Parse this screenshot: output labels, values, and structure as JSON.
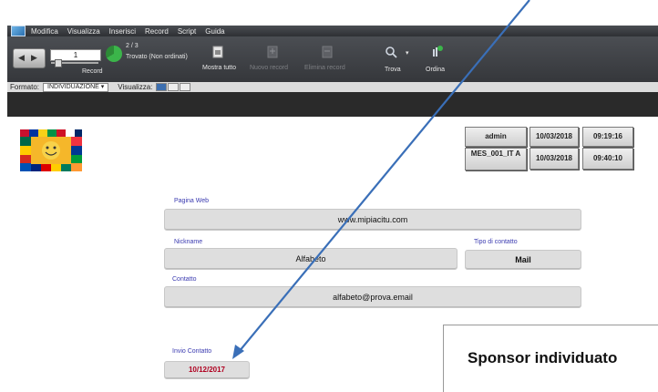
{
  "menu": [
    "Modifica",
    "Visualizza",
    "Inserisci",
    "Record",
    "Script",
    "Guida"
  ],
  "toolbar": {
    "record_number": "1",
    "record_label": "Record",
    "found_count": "2 / 3",
    "found_text": "Trovato (Non ordinati)",
    "show_all": "Mostra tutto",
    "new_record": "Nuovo record",
    "delete_record": "Elimina record",
    "find": "Trova",
    "sort": "Ordina"
  },
  "status": {
    "format_label": "Formato:",
    "layout_value": "INDIVIDUAZIONE",
    "view_label": "Visualizza:"
  },
  "record": {
    "user": "admin",
    "date1": "10/03/2018",
    "time1": "09:19:16",
    "code": "MES_001_IT A",
    "date2": "10/03/2018",
    "time2": "09:40:10"
  },
  "form": {
    "web_label": "Pagina Web",
    "web_value": "www.mipiacitu.com",
    "nickname_label": "Nickname",
    "nickname_value": "Alfabeto",
    "contact_type_label": "Tipo di contatto",
    "contact_type_value": "Mail",
    "contact_label": "Contatto",
    "contact_value": "alfabeto@prova.email",
    "send_label": "Invio Contatto",
    "send_value": "10/12/2017"
  },
  "sponsor": {
    "title": "Sponsor individuato"
  },
  "colors": {
    "annotation_arrow": "#3a6fb8",
    "date_red": "#b00020",
    "label_blue": "#3a3ab0"
  }
}
